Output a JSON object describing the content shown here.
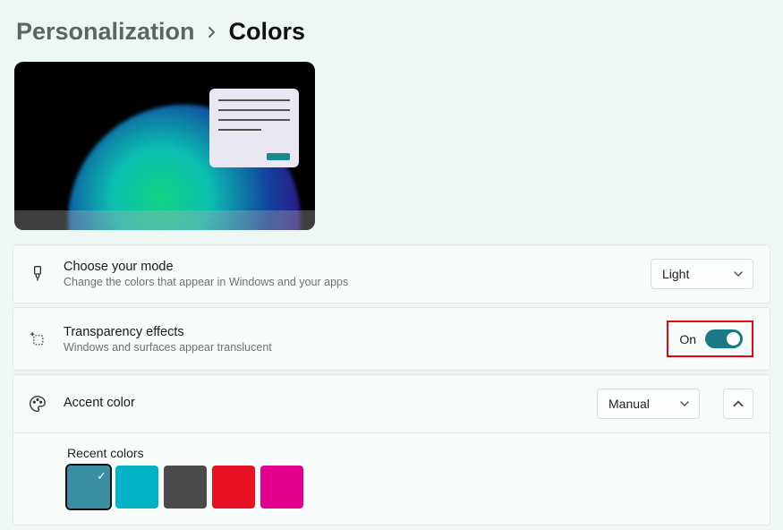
{
  "breadcrumb": {
    "parent": "Personalization",
    "current": "Colors"
  },
  "mode": {
    "title": "Choose your mode",
    "desc": "Change the colors that appear in Windows and your apps",
    "value": "Light"
  },
  "transparency": {
    "title": "Transparency effects",
    "desc": "Windows and surfaces appear translucent",
    "state_label": "On"
  },
  "accent": {
    "title": "Accent color",
    "dropdown": "Manual",
    "recent_label": "Recent colors",
    "recent": [
      {
        "hex": "#3b8fa3",
        "selected": true
      },
      {
        "hex": "#00b3c7",
        "selected": false
      },
      {
        "hex": "#4a4a4a",
        "selected": false
      },
      {
        "hex": "#e81123",
        "selected": false
      },
      {
        "hex": "#e3008c",
        "selected": false
      }
    ]
  }
}
